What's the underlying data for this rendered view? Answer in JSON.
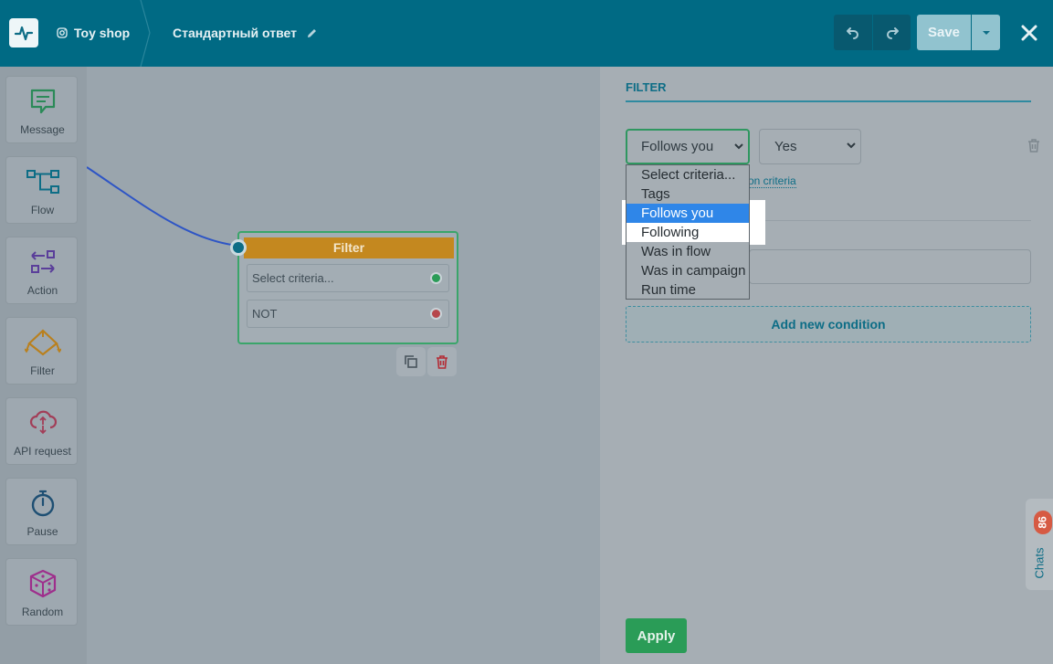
{
  "header": {
    "shop_name": "Toy shop",
    "flow_title": "Стандартный ответ",
    "save_label": "Save"
  },
  "toolbar": {
    "items": [
      {
        "label": "Message"
      },
      {
        "label": "Flow"
      },
      {
        "label": "Action"
      },
      {
        "label": "Filter"
      },
      {
        "label": "API request"
      },
      {
        "label": "Pause"
      },
      {
        "label": "Random"
      }
    ]
  },
  "node": {
    "title": "Filter",
    "row1": "Select criteria...",
    "row2": "NOT"
  },
  "panel": {
    "title": "FILTER",
    "criteria_value": "Follows you",
    "condition_value": "Yes",
    "partial_link": "on criteria",
    "add_condition": "Add new condition",
    "apply_label": "Apply"
  },
  "dropdown": {
    "options": [
      "Select criteria...",
      "Tags",
      "Follows you",
      "Following",
      "Was in flow",
      "Was in campaign",
      "Run time"
    ],
    "selected": "Follows you"
  },
  "chats": {
    "label": "Chats",
    "count": "86"
  },
  "colors": {
    "header_bg": "#006a84",
    "accent": "#0d6d86",
    "apply_green": "#2a9c57",
    "filter_orange": "#c4881f",
    "selected_blue": "#2f86e8"
  }
}
